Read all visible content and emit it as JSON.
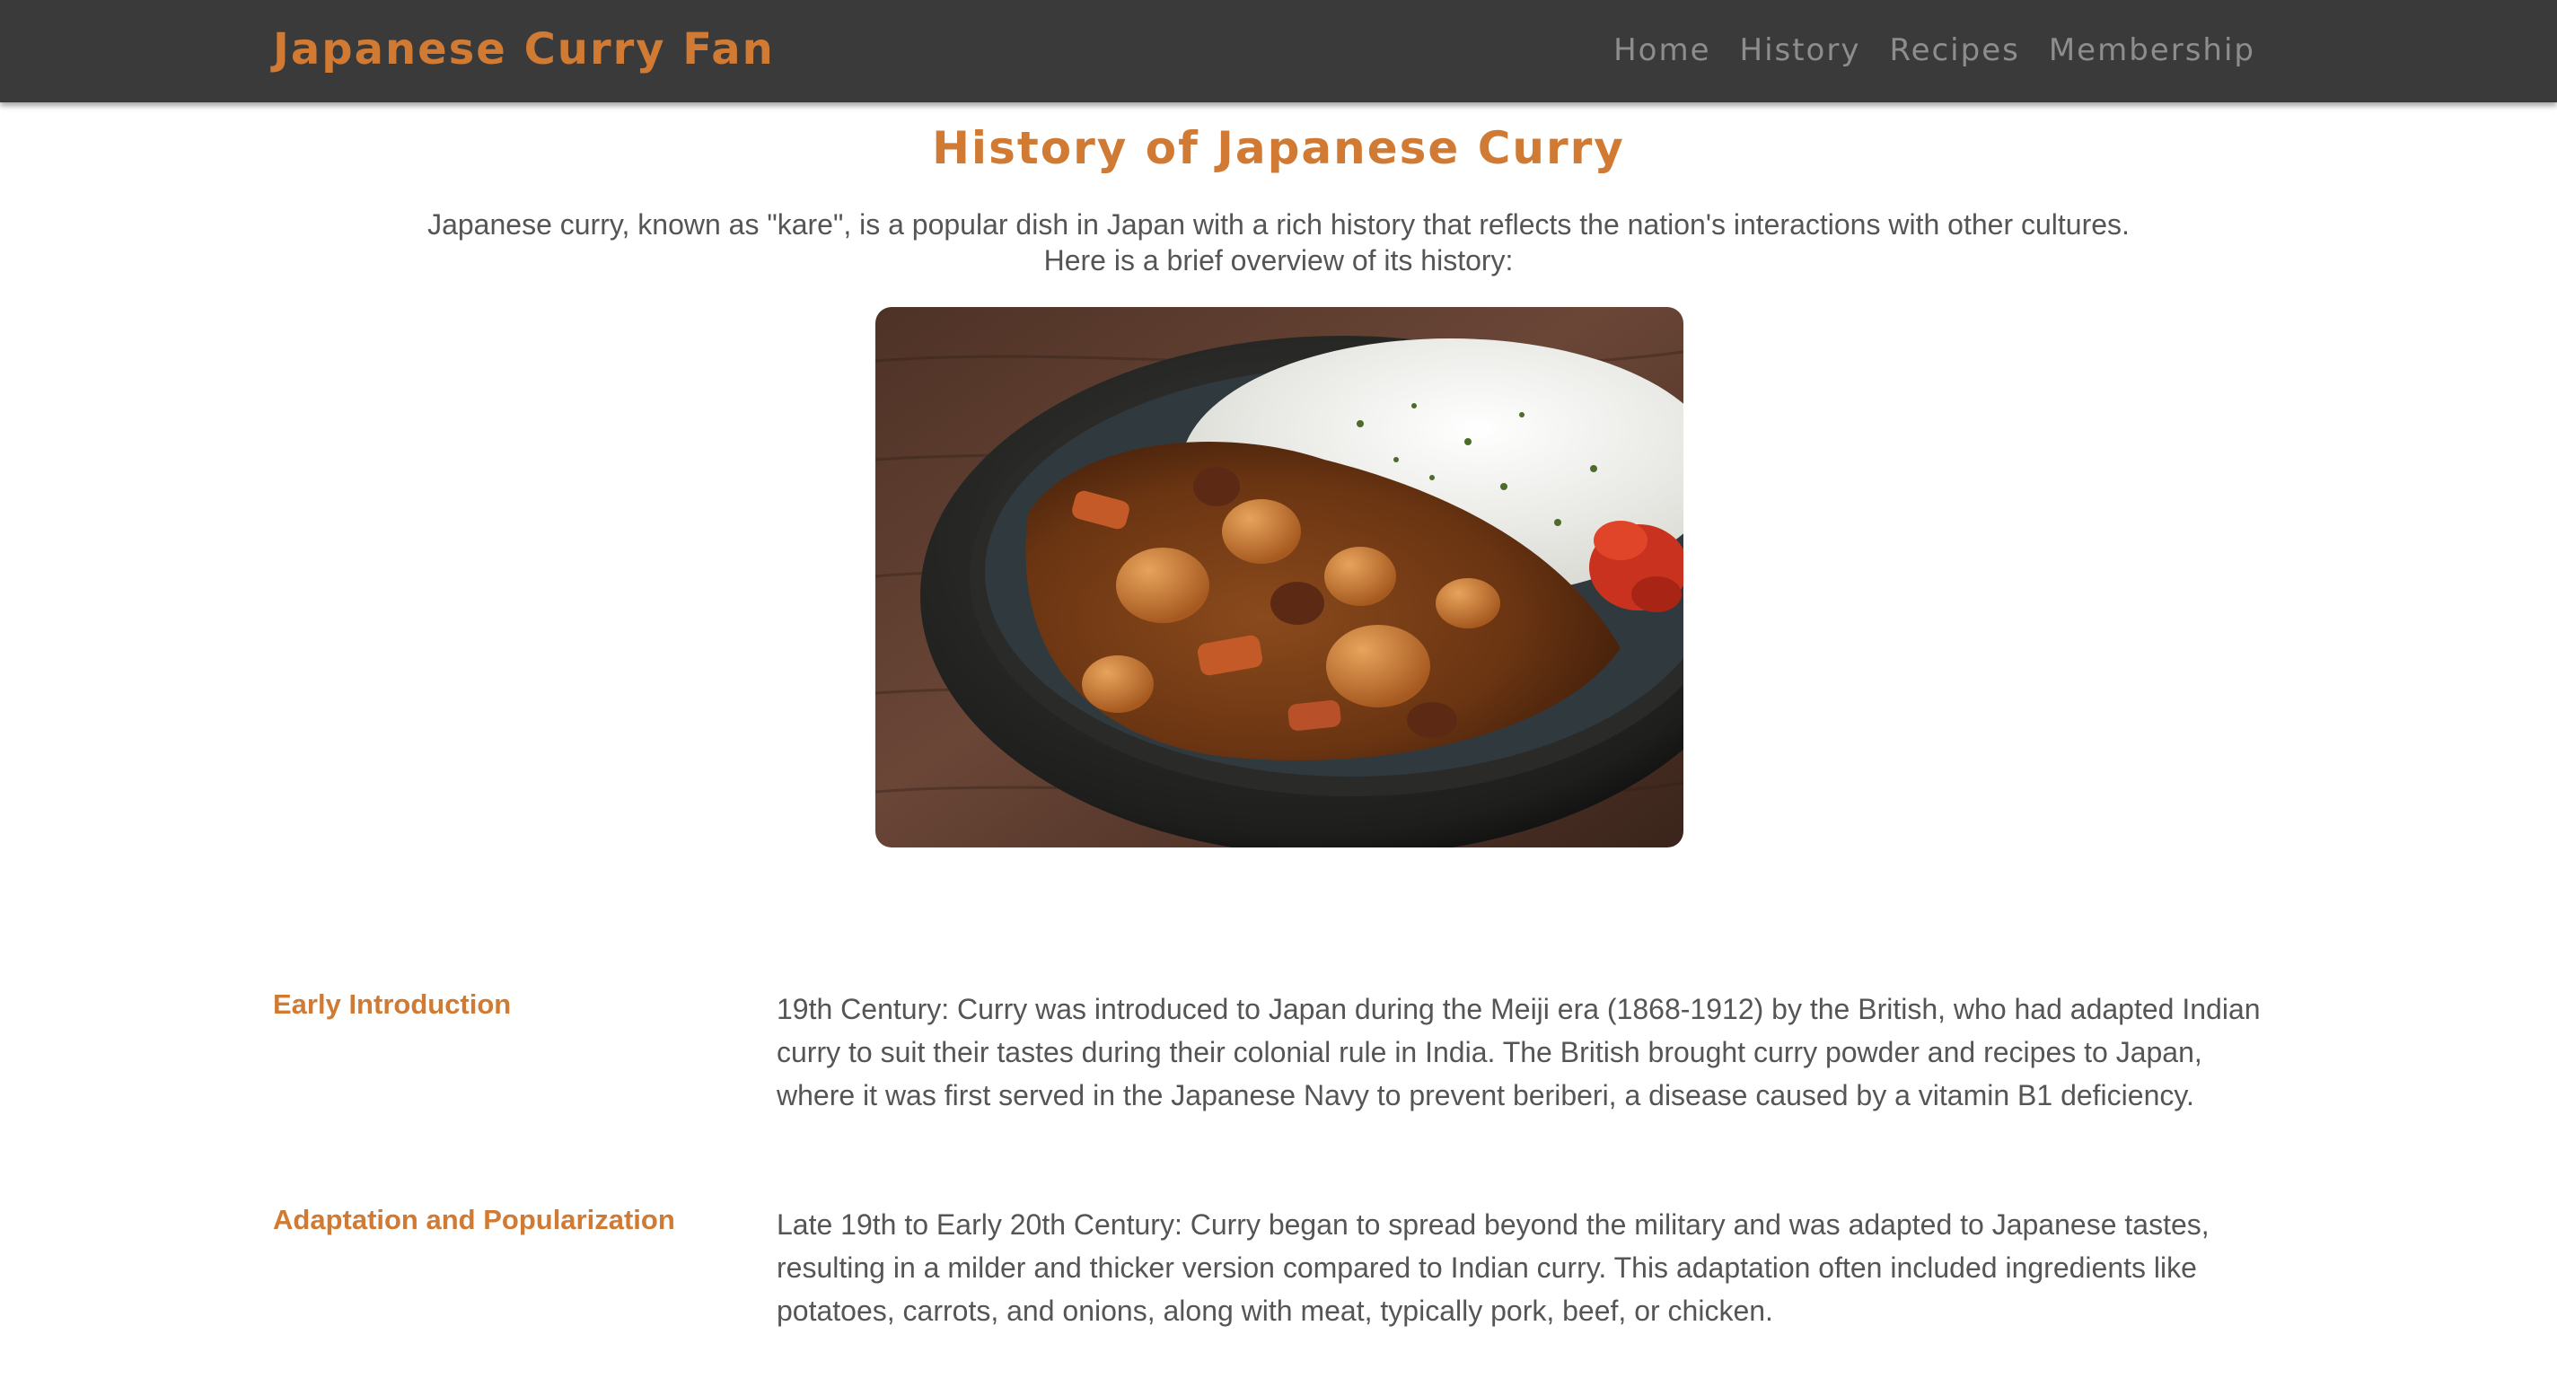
{
  "nav": {
    "brand": "Japanese Curry Fan",
    "links": [
      "Home",
      "History",
      "Recipes",
      "Membership"
    ]
  },
  "hero": {
    "title": "History of Japanese Curry",
    "intro_lines": [
      "Japanese curry, known as \"kare\", is a popular dish in Japan with a rich history that reflects the nation's interactions with other cultures.",
      "Here is a brief overview of its history:"
    ],
    "image_icon": "curry-rice-bowl-photo"
  },
  "sections": [
    {
      "heading": "Early Introduction",
      "lines": [
        "19th Century: Curry was introduced to Japan during the Meiji era (1868-1912) by the British, who had adapted Indian",
        "curry to suit their tastes during their colonial rule in India. The British brought curry powder and recipes to Japan,",
        "where it was first served in the Japanese Navy to prevent beriberi, a disease caused by a vitamin B1 deficiency."
      ]
    },
    {
      "heading": "Adaptation and Popularization",
      "lines": [
        "Late 19th to Early 20th Century: Curry began to spread beyond the military and was adapted to Japanese tastes,",
        "resulting in a milder and thicker version compared to Indian curry. This adaptation often included ingredients like",
        "potatoes, carrots, and onions, along with meat, typically pork, beef, or chicken."
      ]
    }
  ],
  "colors": {
    "accent": "#d07a33",
    "nav_bg": "#3a3a3a",
    "nav_link": "#8d8d8d",
    "body_text": "#555555"
  }
}
